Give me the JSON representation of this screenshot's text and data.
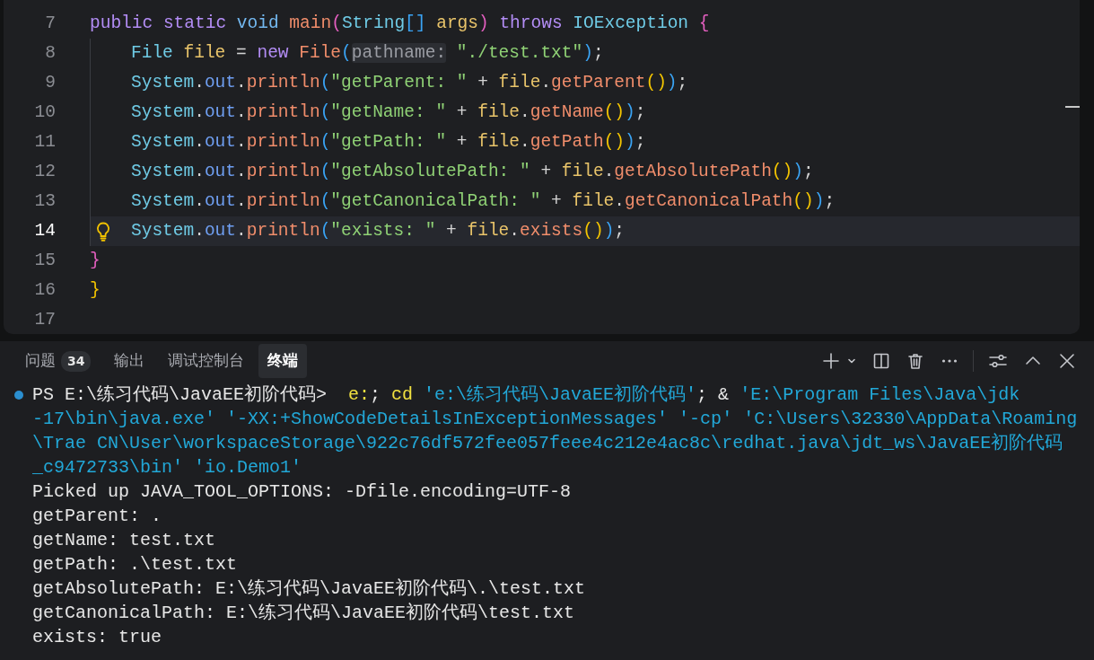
{
  "editor": {
    "lines": [
      {
        "number": "7",
        "selected": false,
        "indented": false,
        "lightbulb": false,
        "tokens": [
          {
            "kind": "kw",
            "text": "public "
          },
          {
            "kind": "kw",
            "text": "static "
          },
          {
            "kind": "kw2",
            "text": "void "
          },
          {
            "kind": "fn",
            "text": "main"
          },
          {
            "kind": "b1",
            "text": "("
          },
          {
            "kind": "type",
            "text": "String"
          },
          {
            "kind": "b2",
            "text": "[] "
          },
          {
            "kind": "var",
            "text": "args"
          },
          {
            "kind": "b1",
            "text": ") "
          },
          {
            "kind": "kw",
            "text": "throws "
          },
          {
            "kind": "type",
            "text": "IOException "
          },
          {
            "kind": "b1",
            "text": "{"
          }
        ]
      },
      {
        "number": "8",
        "selected": false,
        "indented": true,
        "lightbulb": false,
        "tokens": [
          {
            "kind": "type",
            "text": "File "
          },
          {
            "kind": "var",
            "text": "file "
          },
          {
            "kind": "plain",
            "text": "= "
          },
          {
            "kind": "kw",
            "text": "new "
          },
          {
            "kind": "fn",
            "text": "File"
          },
          {
            "kind": "b2",
            "text": "("
          },
          {
            "kind": "hint",
            "text": "pathname:"
          },
          {
            "kind": "str",
            "text": " \"./test.txt\""
          },
          {
            "kind": "b2",
            "text": ")"
          },
          {
            "kind": "plain",
            "text": ";"
          }
        ]
      },
      {
        "number": "9",
        "selected": false,
        "indented": true,
        "lightbulb": false,
        "tokens": [
          {
            "kind": "type",
            "text": "System"
          },
          {
            "kind": "plain",
            "text": "."
          },
          {
            "kind": "field",
            "text": "out"
          },
          {
            "kind": "plain",
            "text": "."
          },
          {
            "kind": "fn",
            "text": "println"
          },
          {
            "kind": "b2",
            "text": "("
          },
          {
            "kind": "str",
            "text": "\"getParent: \" "
          },
          {
            "kind": "plain",
            "text": "+ "
          },
          {
            "kind": "var",
            "text": "file"
          },
          {
            "kind": "plain",
            "text": "."
          },
          {
            "kind": "fn",
            "text": "getParent"
          },
          {
            "kind": "b3",
            "text": "()"
          },
          {
            "kind": "b2",
            "text": ")"
          },
          {
            "kind": "plain",
            "text": ";"
          }
        ]
      },
      {
        "number": "10",
        "selected": false,
        "indented": true,
        "lightbulb": false,
        "tokens": [
          {
            "kind": "type",
            "text": "System"
          },
          {
            "kind": "plain",
            "text": "."
          },
          {
            "kind": "field",
            "text": "out"
          },
          {
            "kind": "plain",
            "text": "."
          },
          {
            "kind": "fn",
            "text": "println"
          },
          {
            "kind": "b2",
            "text": "("
          },
          {
            "kind": "str",
            "text": "\"getName: \" "
          },
          {
            "kind": "plain",
            "text": "+ "
          },
          {
            "kind": "var",
            "text": "file"
          },
          {
            "kind": "plain",
            "text": "."
          },
          {
            "kind": "fn",
            "text": "getName"
          },
          {
            "kind": "b3",
            "text": "()"
          },
          {
            "kind": "b2",
            "text": ")"
          },
          {
            "kind": "plain",
            "text": ";"
          }
        ]
      },
      {
        "number": "11",
        "selected": false,
        "indented": true,
        "lightbulb": false,
        "tokens": [
          {
            "kind": "type",
            "text": "System"
          },
          {
            "kind": "plain",
            "text": "."
          },
          {
            "kind": "field",
            "text": "out"
          },
          {
            "kind": "plain",
            "text": "."
          },
          {
            "kind": "fn",
            "text": "println"
          },
          {
            "kind": "b2",
            "text": "("
          },
          {
            "kind": "str",
            "text": "\"getPath: \" "
          },
          {
            "kind": "plain",
            "text": "+ "
          },
          {
            "kind": "var",
            "text": "file"
          },
          {
            "kind": "plain",
            "text": "."
          },
          {
            "kind": "fn",
            "text": "getPath"
          },
          {
            "kind": "b3",
            "text": "()"
          },
          {
            "kind": "b2",
            "text": ")"
          },
          {
            "kind": "plain",
            "text": ";"
          }
        ]
      },
      {
        "number": "12",
        "selected": false,
        "indented": true,
        "lightbulb": false,
        "tokens": [
          {
            "kind": "type",
            "text": "System"
          },
          {
            "kind": "plain",
            "text": "."
          },
          {
            "kind": "field",
            "text": "out"
          },
          {
            "kind": "plain",
            "text": "."
          },
          {
            "kind": "fn",
            "text": "println"
          },
          {
            "kind": "b2",
            "text": "("
          },
          {
            "kind": "str",
            "text": "\"getAbsolutePath: \" "
          },
          {
            "kind": "plain",
            "text": "+ "
          },
          {
            "kind": "var",
            "text": "file"
          },
          {
            "kind": "plain",
            "text": "."
          },
          {
            "kind": "fn",
            "text": "getAbsolutePath"
          },
          {
            "kind": "b3",
            "text": "()"
          },
          {
            "kind": "b2",
            "text": ")"
          },
          {
            "kind": "plain",
            "text": ";"
          }
        ]
      },
      {
        "number": "13",
        "selected": false,
        "indented": true,
        "lightbulb": false,
        "tokens": [
          {
            "kind": "type",
            "text": "System"
          },
          {
            "kind": "plain",
            "text": "."
          },
          {
            "kind": "field",
            "text": "out"
          },
          {
            "kind": "plain",
            "text": "."
          },
          {
            "kind": "fn",
            "text": "println"
          },
          {
            "kind": "b2",
            "text": "("
          },
          {
            "kind": "str",
            "text": "\"getCanonicalPath: \" "
          },
          {
            "kind": "plain",
            "text": "+ "
          },
          {
            "kind": "var",
            "text": "file"
          },
          {
            "kind": "plain",
            "text": "."
          },
          {
            "kind": "fn",
            "text": "getCanonicalPath"
          },
          {
            "kind": "b3",
            "text": "()"
          },
          {
            "kind": "b2",
            "text": ")"
          },
          {
            "kind": "plain",
            "text": ";"
          }
        ]
      },
      {
        "number": "14",
        "selected": true,
        "indented": true,
        "lightbulb": true,
        "tokens": [
          {
            "kind": "type",
            "text": "System"
          },
          {
            "kind": "plain",
            "text": "."
          },
          {
            "kind": "field",
            "text": "out"
          },
          {
            "kind": "plain",
            "text": "."
          },
          {
            "kind": "fn",
            "text": "println"
          },
          {
            "kind": "b2",
            "text": "("
          },
          {
            "kind": "str",
            "text": "\"exists: \" "
          },
          {
            "kind": "plain",
            "text": "+ "
          },
          {
            "kind": "var",
            "text": "file"
          },
          {
            "kind": "plain",
            "text": "."
          },
          {
            "kind": "fn",
            "text": "exists"
          },
          {
            "kind": "b3",
            "text": "()"
          },
          {
            "kind": "b2",
            "text": ")"
          },
          {
            "kind": "plain",
            "text": ";"
          }
        ]
      },
      {
        "number": "15",
        "selected": false,
        "indented": false,
        "lightbulb": false,
        "tokens": [
          {
            "kind": "b1",
            "text": "}"
          }
        ]
      },
      {
        "number": "16",
        "selected": false,
        "indented": false,
        "lightbulb": false,
        "tokens": [
          {
            "kind": "b3",
            "text": "}"
          }
        ]
      },
      {
        "number": "17",
        "selected": false,
        "indented": false,
        "lightbulb": false
      }
    ]
  },
  "panel": {
    "tabs": [
      {
        "label": "问题",
        "badge": "34",
        "selected": false
      },
      {
        "label": "输出",
        "selected": false
      },
      {
        "label": "调试控制台",
        "selected": false
      },
      {
        "label": "终端",
        "selected": true
      }
    ],
    "terminal": [
      {
        "bullet": true,
        "segments": [
          {
            "kind": "plain",
            "text": "PS E:\\练习代码\\JavaEE初阶代码>  "
          },
          {
            "kind": "cmd",
            "text": "e:"
          },
          {
            "kind": "plain",
            "text": "; "
          },
          {
            "kind": "cmd",
            "text": "cd "
          },
          {
            "kind": "arg",
            "text": "'e:\\练习代码\\JavaEE初阶代码'"
          },
          {
            "kind": "plain",
            "text": "; & "
          },
          {
            "kind": "arg",
            "text": "'E:\\Program Files\\Java\\jdk"
          }
        ]
      },
      {
        "bullet": false,
        "segments": [
          {
            "kind": "arg",
            "text": "-17\\bin\\java.exe' '-XX:+ShowCodeDetailsInExceptionMessages' '-cp' 'C:\\Users\\32330\\AppData\\Roaming"
          }
        ]
      },
      {
        "bullet": false,
        "segments": [
          {
            "kind": "arg",
            "text": "\\Trae CN\\User\\workspaceStorage\\922c76df572fee057feee4c212e4ac8c\\redhat.java\\jdt_ws\\JavaEE初阶代码"
          }
        ]
      },
      {
        "bullet": false,
        "segments": [
          {
            "kind": "arg",
            "text": "_c9472733\\bin' 'io.Demo1'"
          }
        ]
      },
      {
        "bullet": false,
        "segments": [
          {
            "kind": "plain",
            "text": "Picked up JAVA_TOOL_OPTIONS: -Dfile.encoding=UTF-8"
          }
        ]
      },
      {
        "bullet": false,
        "segments": [
          {
            "kind": "plain",
            "text": "getParent: ."
          }
        ]
      },
      {
        "bullet": false,
        "segments": [
          {
            "kind": "plain",
            "text": "getName: test.txt"
          }
        ]
      },
      {
        "bullet": false,
        "segments": [
          {
            "kind": "plain",
            "text": "getPath: .\\test.txt"
          }
        ]
      },
      {
        "bullet": false,
        "segments": [
          {
            "kind": "plain",
            "text": "getAbsolutePath: E:\\练习代码\\JavaEE初阶代码\\.\\test.txt"
          }
        ]
      },
      {
        "bullet": false,
        "segments": [
          {
            "kind": "plain",
            "text": "getCanonicalPath: E:\\练习代码\\JavaEE初阶代码\\test.txt"
          }
        ]
      },
      {
        "bullet": false,
        "segments": [
          {
            "kind": "plain",
            "text": "exists: true"
          }
        ]
      }
    ]
  }
}
